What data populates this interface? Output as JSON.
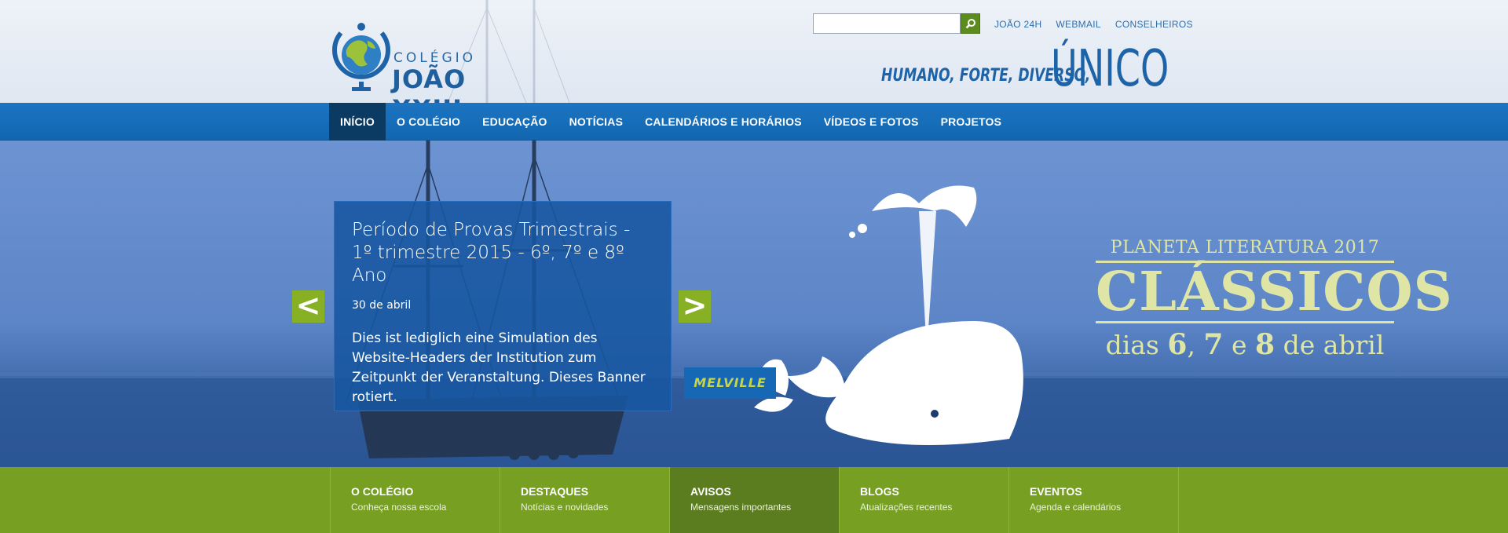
{
  "header": {
    "logo": {
      "top": "COLÉGIO",
      "bottom": "JOÃO XXIII"
    },
    "search": {
      "placeholder": "",
      "button_icon": "search-icon"
    },
    "top_links": [
      "JOÃO 24H",
      "WEBMAIL",
      "CONSELHEIROS"
    ],
    "tagline": {
      "small": "HUMANO, FORTE, DIVERSO,",
      "big": "ÚNICO"
    }
  },
  "nav": {
    "items": [
      "INÍCIO",
      "O COLÉGIO",
      "EDUCAÇÃO",
      "NOTÍCIAS",
      "CALENDÁRIOS E HORÁRIOS",
      "VÍDEOS E FOTOS",
      "PROJETOS"
    ],
    "active_index": 0
  },
  "banner": {
    "card": {
      "title": "Período de Provas Trimestrais - 1º trimestre 2015 - 6º, 7º e 8º Ano",
      "date": "30 de abril",
      "body": "Dies ist lediglich eine Simulation des Website-Headers der Institution zum Zeitpunkt der Veranstaltung. Dieses Banner rotiert."
    },
    "prev": "<",
    "next": ">",
    "tag": "MELVILLE",
    "promo": {
      "line1": "PLANETA LITERATURA 2017",
      "line2": "CLÁSSICOS",
      "line3_prefix": "dias",
      "d1": "6",
      "d2": "7",
      "conj": "e",
      "d3": "8",
      "line3_suffix": "de abril"
    }
  },
  "tiles": [
    {
      "title": "O COLÉGIO",
      "subtitle": "Conheça nossa escola"
    },
    {
      "title": "DESTAQUES",
      "subtitle": "Notícias e novidades"
    },
    {
      "title": "AVISOS",
      "subtitle": "Mensagens importantes"
    },
    {
      "title": "BLOGS",
      "subtitle": "Atualizações recentes"
    },
    {
      "title": "EVENTOS",
      "subtitle": "Agenda e calendários"
    }
  ],
  "colors": {
    "nav_blue": "#1b75c2",
    "nav_active": "#0b3a63",
    "green_bar": "#77a023",
    "green_active": "#5b7d20",
    "promo_text": "#dfe6a5"
  }
}
